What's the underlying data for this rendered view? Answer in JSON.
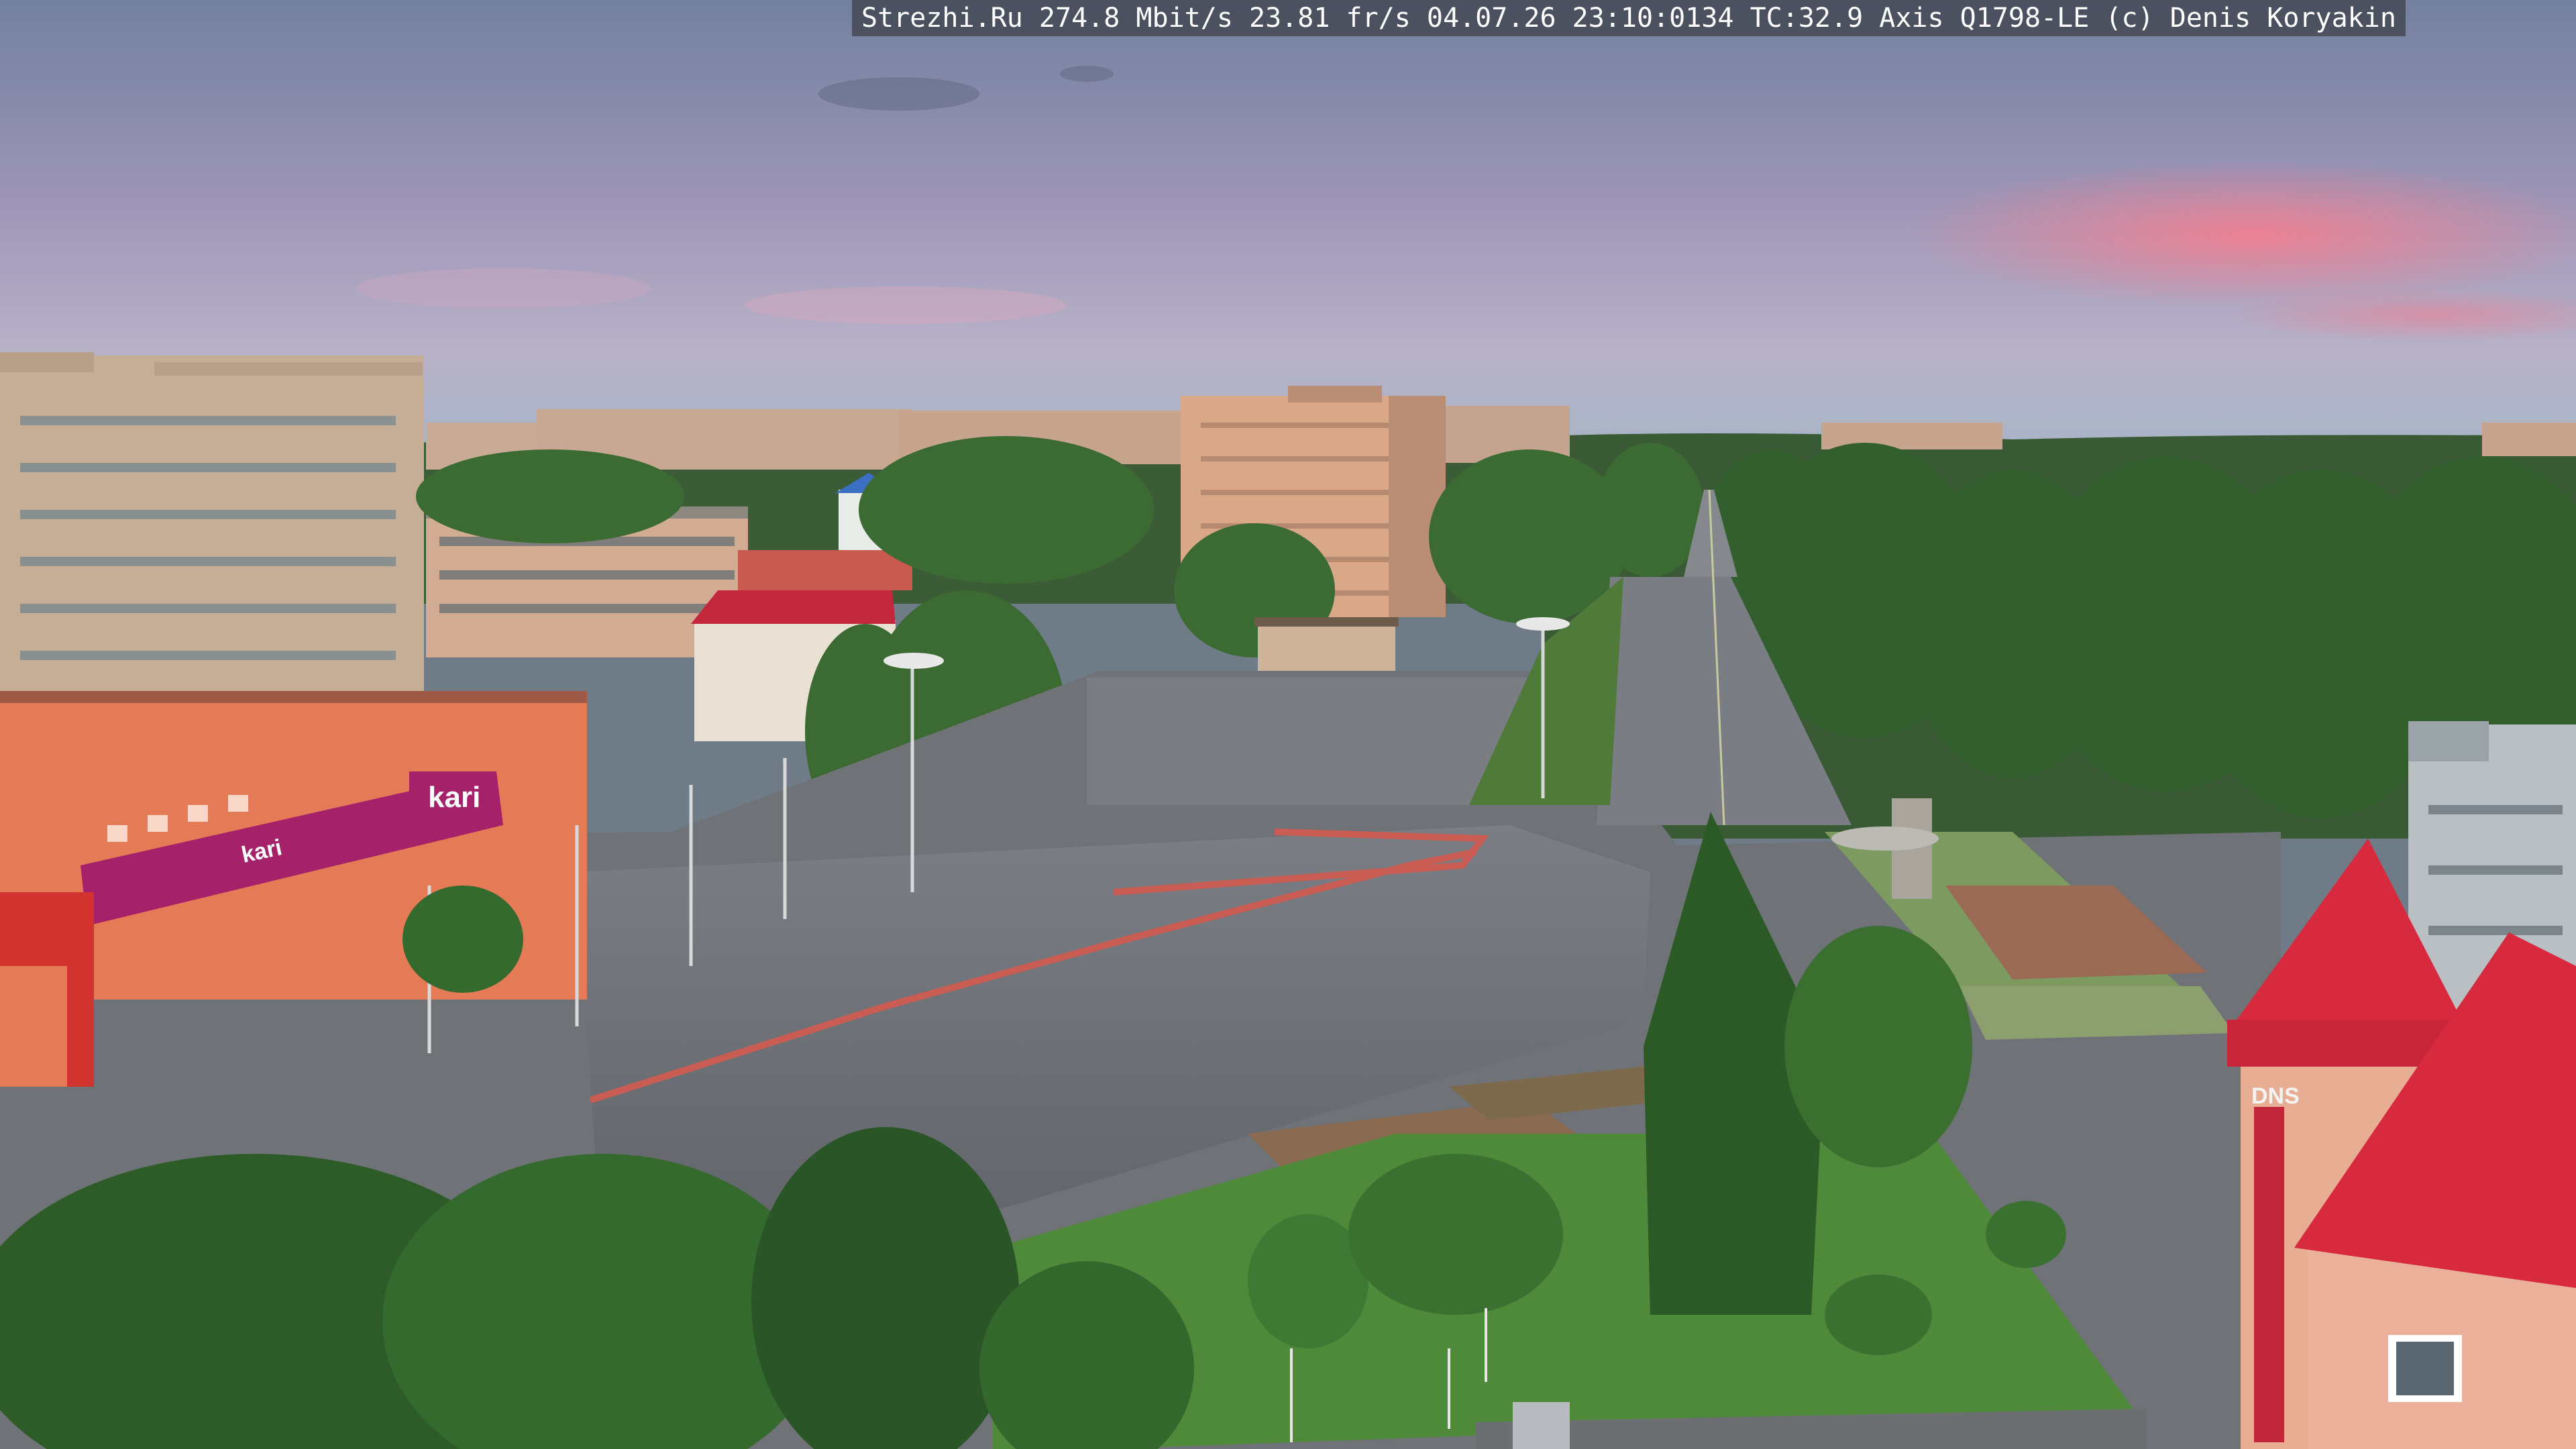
{
  "overlay": {
    "site": "Strezhi.Ru",
    "bitrate": "274.8 Mbit/s",
    "framerate": "23.81 fr/s",
    "date": "04.07.26",
    "time": "23:10:0134",
    "temperature": "TC:32.9",
    "camera": "Axis Q1798-LE",
    "credit": "(c) Denis Koryakin"
  },
  "signs": {
    "kari_brand": "kari",
    "kari_brand_small": "kari",
    "dns_brand": "DNS"
  },
  "colors": {
    "sky_top": "#7c8ab0",
    "sky_horizon": "#b7a6bf",
    "sunset_pink": "#f2889a",
    "trees": "#2f5a2a",
    "road": "#6a6d72",
    "brick_building": "#d6a583",
    "red_roof": "#d62a3c"
  }
}
